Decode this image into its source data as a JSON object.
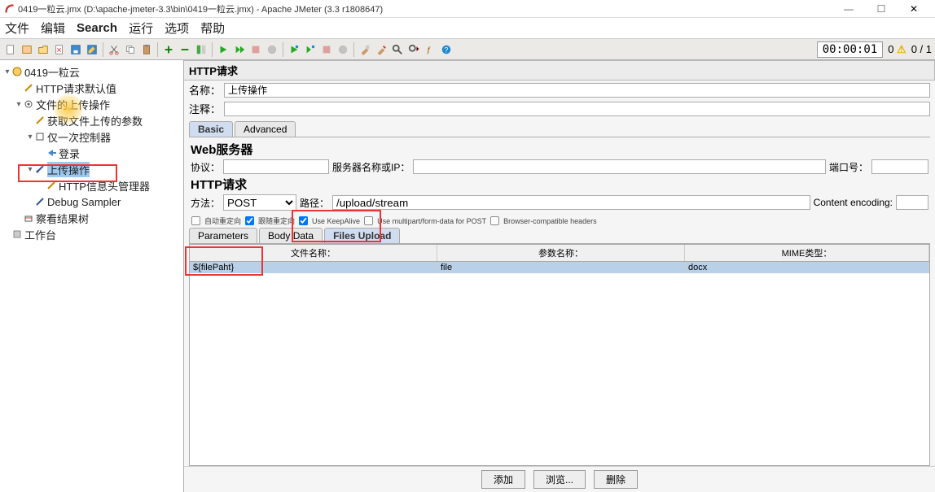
{
  "window": {
    "title": "0419一粒云.jmx (D:\\apache-jmeter-3.3\\bin\\0419一粒云.jmx) - Apache JMeter (3.3 r1808647)"
  },
  "menu": [
    "文件",
    "编辑",
    "Search",
    "运行",
    "选项",
    "帮助"
  ],
  "status": {
    "timer": "00:00:01",
    "warn_count": "0",
    "counter": "0 / 1"
  },
  "tree": {
    "root": "0419一粒云",
    "n_http_default": "HTTP请求默认值",
    "n_upload_op_group": "文件的上传操作",
    "n_get_params": "获取文件上传的参数",
    "n_once_ctrl": "仅一次控制器",
    "n_login": "登录",
    "n_upload_op": "上传操作",
    "n_header_mgr": "HTTP信息头管理器",
    "n_debug": "Debug Sampler",
    "n_view_results": "察看结果树",
    "n_workbench": "工作台"
  },
  "panel": {
    "title": "HTTP请求",
    "name_label": "名称：",
    "name_value": "上传操作",
    "comment_label": "注释：",
    "comment_value": "",
    "tab_basic": "Basic",
    "tab_advanced": "Advanced",
    "web_server_h": "Web服务器",
    "protocol_label": "协议：",
    "protocol_value": "",
    "server_label": "服务器名称或IP：",
    "server_value": "",
    "port_label": "端口号：",
    "port_value": "",
    "http_req_h": "HTTP请求",
    "method_label": "方法：",
    "method_value": "POST",
    "path_label": "路径：",
    "path_value": "/upload/stream",
    "encoding_label": "Content encoding:",
    "encoding_value": "",
    "chk_auto": "自动重定向",
    "chk_follow": "跟随重定向",
    "chk_keepalive": "Use KeepAlive",
    "chk_multipart": "Use multipart/form-data for POST",
    "chk_browser": "Browser-compatible headers",
    "tab_params": "Parameters",
    "tab_body": "Body Data",
    "tab_files": "Files Upload",
    "col_file": "文件名称：",
    "col_param": "参数名称：",
    "col_mime": "MIME类型：",
    "row": {
      "file": "${filePaht}",
      "param": "file",
      "mime": "docx"
    },
    "btn_add": "添加",
    "btn_browse": "浏览...",
    "btn_delete": "删除"
  }
}
